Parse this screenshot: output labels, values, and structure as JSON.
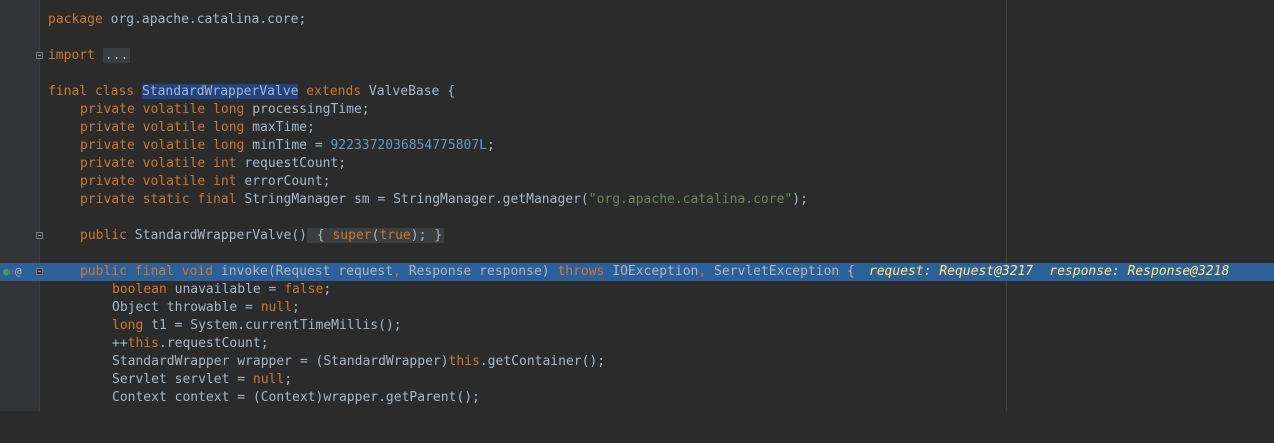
{
  "editor": {
    "package_line": {
      "kw": "package",
      "name": " org.apache.catalina.core;"
    },
    "import_line": {
      "kw": "import",
      "folded": "..."
    },
    "class_decl": {
      "kw1": "final",
      "kw2": " class ",
      "name": "StandardWrapperValve",
      "kw3": " extends",
      "rest": " ValveBase {"
    },
    "fields": [
      {
        "kw": "private volatile long",
        "rest": " processingTime;"
      },
      {
        "kw": "private volatile long",
        "rest": " maxTime;"
      },
      {
        "kw": "private volatile long",
        "rest": " minTime = ",
        "num": "9223372036854775807L",
        "end": ";"
      },
      {
        "kw": "private volatile int",
        "rest": " requestCount;"
      },
      {
        "kw": "private volatile int",
        "rest": " errorCount;"
      },
      {
        "kw": "private static final",
        "rest": " StringManager sm = StringManager.getManager(",
        "str": "\"org.apache.catalina.core\"",
        "end": ");"
      }
    ],
    "constructor": {
      "kw": "public",
      "rest": " StandardWrapperValve()",
      "open": " { ",
      "body_kw": "super",
      "body_rest": "(",
      "body_val": "true",
      "body_end": ");",
      "close": " }"
    },
    "invoke": {
      "kw": "public final void",
      "sig1": " invoke(Request request",
      "comma1": ", ",
      "sig2": "Response response)",
      "throws_kw": " throws",
      "exc1": " IOException",
      "comma2": ", ",
      "exc2": "ServletException {",
      "inline1": "request: Request@3217",
      "inline2": "response: Response@3218"
    },
    "body": [
      {
        "type": "boolean",
        "rest": " unavailable = ",
        "kw2": "false",
        "end": ";"
      },
      {
        "pre": "Object throwable = ",
        "kw2": "null",
        "end": ";"
      },
      {
        "type": "long",
        "rest": " t1 = System.currentTimeMillis();"
      },
      {
        "pre": "++",
        "kw2": "this",
        "end": ".requestCount;"
      },
      {
        "pre": "StandardWrapper wrapper = (StandardWrapper)",
        "kw2": "this",
        "end": ".getContainer();"
      },
      {
        "pre": "Servlet servlet = ",
        "kw2": "null",
        "end": ";"
      },
      {
        "pre": "Context context = (Context)wrapper.getParent();"
      }
    ]
  },
  "gutter": {
    "override_icon": "override-arrow-icon",
    "annotation_icon": "at-icon",
    "breakpoint_icon": "execution-point-icon"
  },
  "colors": {
    "background": "#2b2b2b",
    "keyword": "#cc7832",
    "number": "#6897bb",
    "string": "#6a8759",
    "plain": "#a9b7c6",
    "current_line": "#2d6099",
    "inline_debug": "#ffeb7a"
  }
}
